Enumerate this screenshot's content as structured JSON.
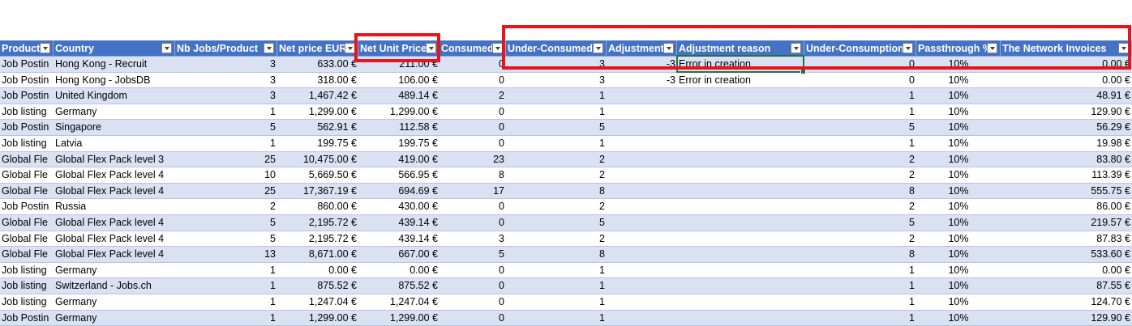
{
  "headers": [
    "Product",
    "Country",
    "Nb Jobs/Product",
    "Net price EUR",
    "Net Unit Price",
    "Consumed",
    "Under-Consumed",
    "Adjustment",
    "Adjustment reason",
    "Under-Consumption",
    "Passthrough %",
    "The Network Invoices"
  ],
  "rows": [
    {
      "product": "Job Postin",
      "country": "Hong Kong - Recruit",
      "nb_jobs": "3",
      "net_price": "633.00 €",
      "unit_price": "211.00 €",
      "consumed": "0",
      "under_consumed": "3",
      "adjustment": "-3",
      "reason": "Error in creation",
      "under_consumption": "0",
      "passthrough": "10%",
      "invoices": "0.00 €"
    },
    {
      "product": "Job Postin",
      "country": "Hong Kong - JobsDB",
      "nb_jobs": "3",
      "net_price": "318.00 €",
      "unit_price": "106.00 €",
      "consumed": "0",
      "under_consumed": "3",
      "adjustment": "-3",
      "reason": "Error in creation",
      "under_consumption": "0",
      "passthrough": "10%",
      "invoices": "0.00 €"
    },
    {
      "product": "Job Postin",
      "country": "United Kingdom",
      "nb_jobs": "3",
      "net_price": "1,467.42 €",
      "unit_price": "489.14 €",
      "consumed": "2",
      "under_consumed": "1",
      "adjustment": "",
      "reason": "",
      "under_consumption": "1",
      "passthrough": "10%",
      "invoices": "48.91 €"
    },
    {
      "product": "Job listing",
      "country": "Germany",
      "nb_jobs": "1",
      "net_price": "1,299.00 €",
      "unit_price": "1,299.00 €",
      "consumed": "0",
      "under_consumed": "1",
      "adjustment": "",
      "reason": "",
      "under_consumption": "1",
      "passthrough": "10%",
      "invoices": "129.90 €"
    },
    {
      "product": "Job Postin",
      "country": "Singapore",
      "nb_jobs": "5",
      "net_price": "562.91 €",
      "unit_price": "112.58 €",
      "consumed": "0",
      "under_consumed": "5",
      "adjustment": "",
      "reason": "",
      "under_consumption": "5",
      "passthrough": "10%",
      "invoices": "56.29 €"
    },
    {
      "product": "Job listing",
      "country": "Latvia",
      "nb_jobs": "1",
      "net_price": "199.75 €",
      "unit_price": "199.75 €",
      "consumed": "0",
      "under_consumed": "1",
      "adjustment": "",
      "reason": "",
      "under_consumption": "1",
      "passthrough": "10%",
      "invoices": "19.98 €"
    },
    {
      "product": "Global Fle",
      "country": "Global Flex Pack level 3",
      "nb_jobs": "25",
      "net_price": "10,475.00 €",
      "unit_price": "419.00 €",
      "consumed": "23",
      "under_consumed": "2",
      "adjustment": "",
      "reason": "",
      "under_consumption": "2",
      "passthrough": "10%",
      "invoices": "83.80 €"
    },
    {
      "product": "Global Fle",
      "country": "Global Flex Pack level 4",
      "nb_jobs": "10",
      "net_price": "5,669.50 €",
      "unit_price": "566.95 €",
      "consumed": "8",
      "under_consumed": "2",
      "adjustment": "",
      "reason": "",
      "under_consumption": "2",
      "passthrough": "10%",
      "invoices": "113.39 €"
    },
    {
      "product": "Global Fle",
      "country": "Global Flex Pack level 4",
      "nb_jobs": "25",
      "net_price": "17,367.19 €",
      "unit_price": "694.69 €",
      "consumed": "17",
      "under_consumed": "8",
      "adjustment": "",
      "reason": "",
      "under_consumption": "8",
      "passthrough": "10%",
      "invoices": "555.75 €"
    },
    {
      "product": "Job Postin",
      "country": "Russia",
      "nb_jobs": "2",
      "net_price": "860.00 €",
      "unit_price": "430.00 €",
      "consumed": "0",
      "under_consumed": "2",
      "adjustment": "",
      "reason": "",
      "under_consumption": "2",
      "passthrough": "10%",
      "invoices": "86.00 €"
    },
    {
      "product": "Global Fle",
      "country": "Global Flex Pack level 4",
      "nb_jobs": "5",
      "net_price": "2,195.72 €",
      "unit_price": "439.14 €",
      "consumed": "0",
      "under_consumed": "5",
      "adjustment": "",
      "reason": "",
      "under_consumption": "5",
      "passthrough": "10%",
      "invoices": "219.57 €"
    },
    {
      "product": "Global Fle",
      "country": "Global Flex Pack level 4",
      "nb_jobs": "5",
      "net_price": "2,195.72 €",
      "unit_price": "439.14 €",
      "consumed": "3",
      "under_consumed": "2",
      "adjustment": "",
      "reason": "",
      "under_consumption": "2",
      "passthrough": "10%",
      "invoices": "87.83 €"
    },
    {
      "product": "Global Fle",
      "country": "Global Flex Pack level 4",
      "nb_jobs": "13",
      "net_price": "8,671.00 €",
      "unit_price": "667.00 €",
      "consumed": "5",
      "under_consumed": "8",
      "adjustment": "",
      "reason": "",
      "under_consumption": "8",
      "passthrough": "10%",
      "invoices": "533.60 €"
    },
    {
      "product": "Job listing",
      "country": "Germany",
      "nb_jobs": "1",
      "net_price": "0.00 €",
      "unit_price": "0.00 €",
      "consumed": "0",
      "under_consumed": "1",
      "adjustment": "",
      "reason": "",
      "under_consumption": "1",
      "passthrough": "10%",
      "invoices": "0.00 €"
    },
    {
      "product": "Job listing",
      "country": "Switzerland - Jobs.ch",
      "nb_jobs": "1",
      "net_price": "875.52 €",
      "unit_price": "875.52 €",
      "consumed": "0",
      "under_consumed": "1",
      "adjustment": "",
      "reason": "",
      "under_consumption": "1",
      "passthrough": "10%",
      "invoices": "87.55 €"
    },
    {
      "product": "Job listing",
      "country": "Germany",
      "nb_jobs": "1",
      "net_price": "1,247.04 €",
      "unit_price": "1,247.04 €",
      "consumed": "0",
      "under_consumed": "1",
      "adjustment": "",
      "reason": "",
      "under_consumption": "1",
      "passthrough": "10%",
      "invoices": "124.70 €"
    },
    {
      "product": "Job Postin",
      "country": "Germany",
      "nb_jobs": "1",
      "net_price": "1,299.00 €",
      "unit_price": "1,299.00 €",
      "consumed": "0",
      "under_consumed": "1",
      "adjustment": "",
      "reason": "",
      "under_consumption": "1",
      "passthrough": "10%",
      "invoices": "129.90 €"
    }
  ],
  "colors": {
    "header_bg": "#4472c4",
    "band_bg": "#d9e1f2",
    "highlight_box": "#e8141b",
    "selection": "#217346"
  }
}
